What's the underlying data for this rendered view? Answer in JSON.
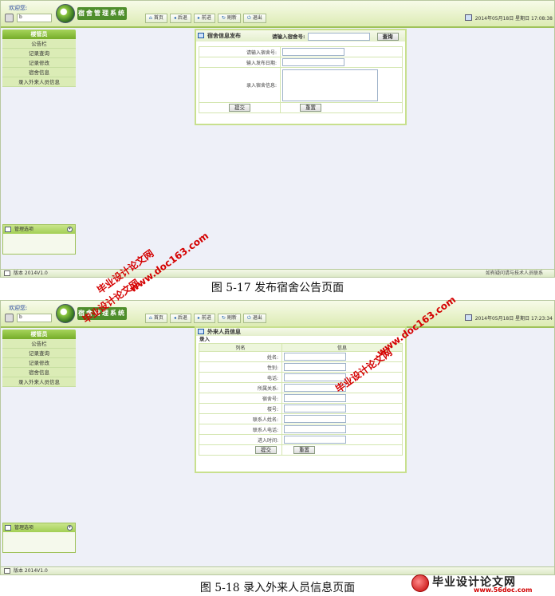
{
  "app": {
    "welcome": "欢迎您:",
    "user": "b",
    "logo_title": "宿舍管理系统",
    "nav": [
      "首页",
      "后退",
      "前进",
      "刷新",
      "退出"
    ],
    "nav_icons": [
      "home-icon",
      "back-icon",
      "forward-icon",
      "refresh-icon",
      "logout-icon"
    ],
    "sidebar_title": "楼管员",
    "sidebar_items": [
      "公告栏",
      "记录查询",
      "记录修改",
      "宿舍信息",
      "录入外来人员信息"
    ],
    "mgmt_label": "管理选项",
    "status_version": "版本 2014V1.0",
    "status_right": "如有疑问请与技术人员联系"
  },
  "screen1": {
    "datetime": "2014年05月18日 星期日 17:08:38",
    "panel_title": "宿舍信息发布",
    "search_label": "请输入宿舍号:",
    "search_button": "查询",
    "fields": [
      "请输入宿舍号:",
      "输入发布日期:",
      "录入宿舍信息:"
    ],
    "submit": "提交",
    "reset": "重置"
  },
  "caption1": "图 5-17  发布宿舍公告页面",
  "screen2": {
    "datetime": "2014年05月18日 星期日 17:23:34",
    "panel_title": "外来人员信息",
    "sub_title": "录入",
    "col_name": "列名",
    "col_info": "信息",
    "fields": [
      "姓名:",
      "性别:",
      "电话:",
      "所属关系:",
      "宿舍号:",
      "楼号:",
      "联系人姓名:",
      "联系人电话:",
      "进入时间:"
    ],
    "submit": "提交",
    "reset": "重置"
  },
  "caption2": "图 5-18  录入外来人员信息页面",
  "watermark": {
    "line1": "毕业设计论文网",
    "line2": "www.doc163.com",
    "logo_text": "毕业设计论文网",
    "logo_url": "www.56doc.com"
  },
  "colors": {
    "accent_green": "#9fc25a",
    "watermark_red": "#d40000"
  }
}
